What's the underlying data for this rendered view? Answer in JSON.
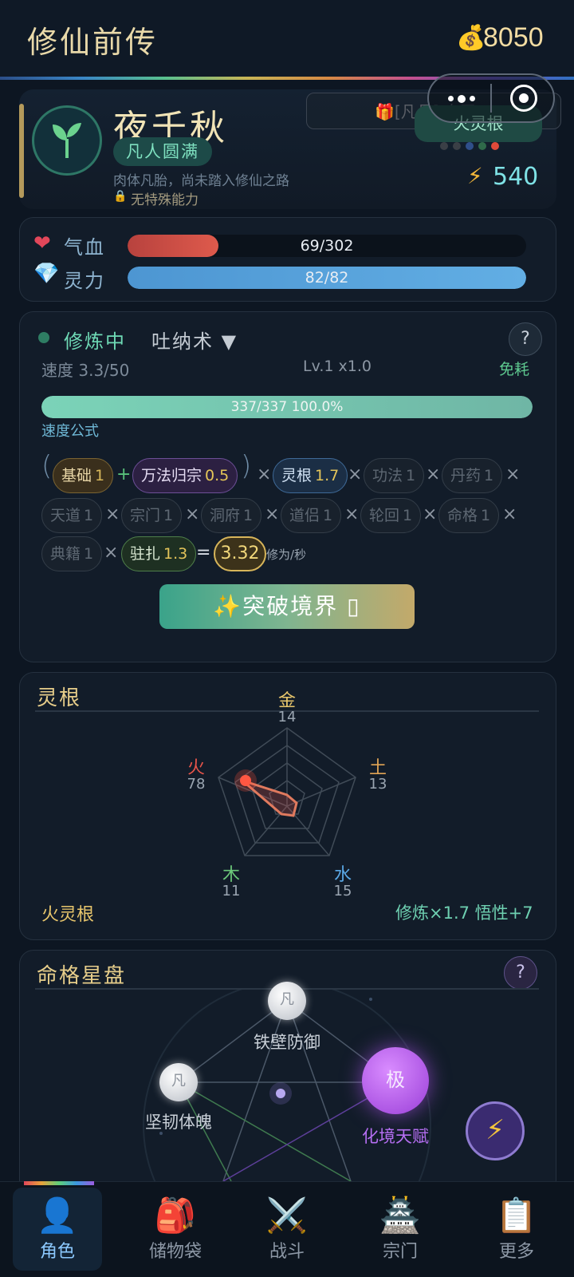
{
  "app": {
    "title": "修仙前传",
    "coin_icon": "money-bag-icon",
    "coins": "8050"
  },
  "capsule": {
    "menu_icon": "more-dots-icon",
    "close_icon": "target-ring-icon"
  },
  "profile": {
    "name": "夜千秋",
    "realm": "凡人圆满",
    "description": "肉体凡胎，尚未踏入修仙之路",
    "ability": "无特殊能力",
    "gift_text": "[凡品] 身王",
    "root_badge": "火灵根",
    "root_dots": [
      "#3a3f46",
      "#3a3f46",
      "#2f4f8a",
      "#2f6a4a",
      "#e04a3a"
    ],
    "energy": "540"
  },
  "stats": {
    "hp": {
      "label": "气血",
      "text": "69/302",
      "current": 69,
      "max": 302,
      "color": "#d2473f"
    },
    "mp": {
      "label": "灵力",
      "text": "82/82",
      "current": 82,
      "max": 82,
      "color": "#4a95d6"
    }
  },
  "cultivation": {
    "status": "修炼中",
    "technique": "吐纳术 ▼",
    "help": "?",
    "speed": "速度 3.3/50",
    "level": "Lv.1 x1.0",
    "cost": "免耗",
    "progress_text": "337/337  100.0%",
    "progress_fraction": 1.0,
    "formula_label": "速度公式",
    "chips": {
      "base": {
        "label": "基础",
        "value": "1"
      },
      "wanfa": {
        "label": "万法归宗",
        "value": "0.5"
      },
      "root": {
        "label": "灵根",
        "value": "1.7"
      },
      "gongfa": {
        "label": "功法",
        "value": "1"
      },
      "danyao": {
        "label": "丹药",
        "value": "1"
      },
      "tiandao": {
        "label": "天道",
        "value": "1"
      },
      "zongmen": {
        "label": "宗门",
        "value": "1"
      },
      "dongfu": {
        "label": "洞府",
        "value": "1"
      },
      "daolv": {
        "label": "道侣",
        "value": "1"
      },
      "lunhui": {
        "label": "轮回",
        "value": "1"
      },
      "mingge": {
        "label": "命格",
        "value": "1"
      },
      "dianji": {
        "label": "典籍",
        "value": "1"
      },
      "zhuzha": {
        "label": "驻扎",
        "value": "1.3"
      }
    },
    "ops": {
      "plus": "+",
      "times": "×",
      "equals": "=",
      "open": "(",
      "close": ")"
    },
    "result": "3.32",
    "result_unit": "修为/秒",
    "breakthrough": "✨突破境界 ▯"
  },
  "spirit_root": {
    "title": "灵根",
    "elements": [
      {
        "name": "金",
        "value": "14",
        "color": "#e8c66c"
      },
      {
        "name": "土",
        "value": "13",
        "color": "#e0a455"
      },
      {
        "name": "水",
        "value": "15",
        "color": "#5aa8e6"
      },
      {
        "name": "木",
        "value": "11",
        "color": "#6cc87a"
      },
      {
        "name": "火",
        "value": "78",
        "color": "#e5544a"
      }
    ],
    "name": "火灵根",
    "bonus": "修炼×1.7  悟性+7"
  },
  "fate": {
    "title": "命格星盘",
    "help": "?",
    "nodes": {
      "top": {
        "glyph": "凡",
        "label": "铁壁防御"
      },
      "left": {
        "glyph": "凡",
        "label": "坚韧体魄"
      },
      "right": {
        "glyph": "极",
        "label": "化境天赋"
      }
    },
    "fab_icon": "⚡"
  },
  "nav": [
    {
      "icon": "👤",
      "label": "角色",
      "active": true
    },
    {
      "icon": "🎒",
      "label": "储物袋"
    },
    {
      "icon": "⚔️",
      "label": "战斗"
    },
    {
      "icon": "🏯",
      "label": "宗门"
    },
    {
      "icon": "📋",
      "label": "更多"
    }
  ]
}
